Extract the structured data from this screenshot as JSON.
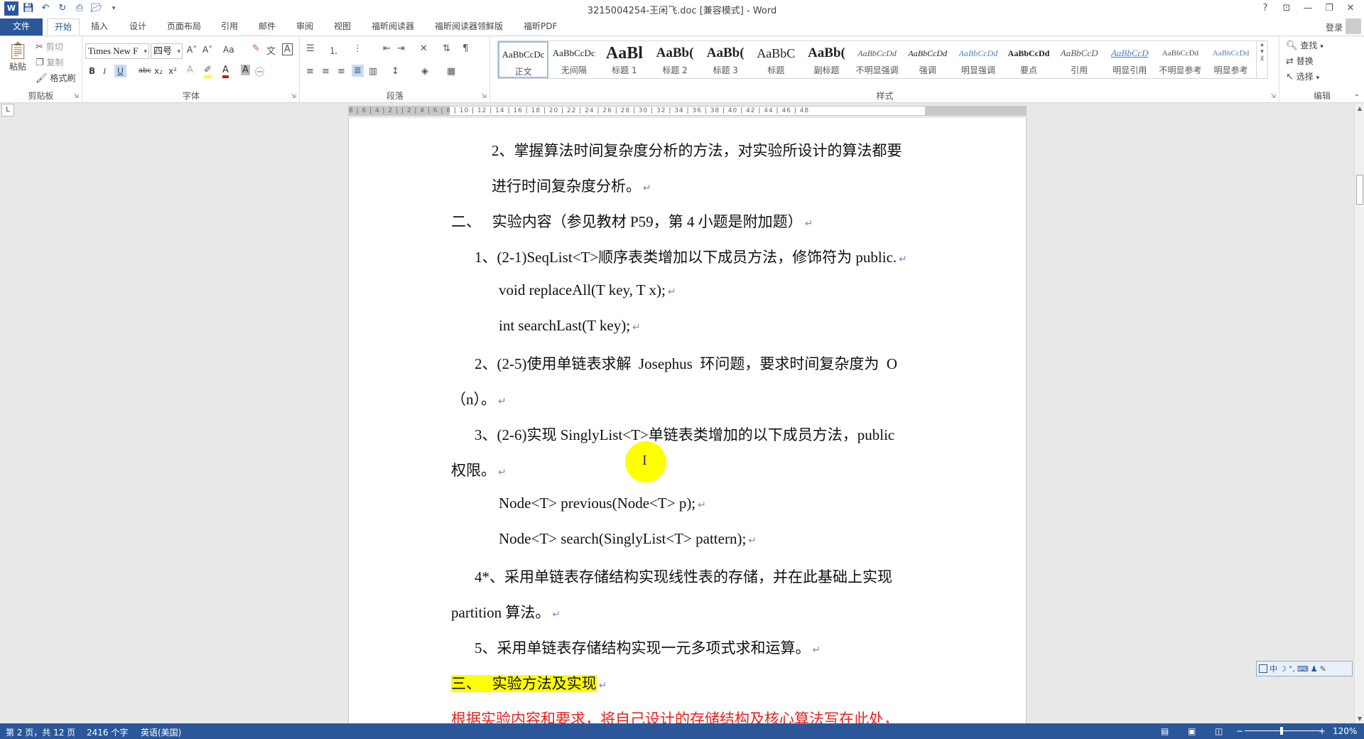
{
  "title_bar": {
    "title": "3215004254-王闲飞.doc [兼容模式] - Word",
    "controls": {
      "help": "?",
      "ribbon_display": "⊡",
      "minimize": "—",
      "restore": "❐",
      "close": "✕"
    }
  },
  "tabs": {
    "items": [
      {
        "label": "文件"
      },
      {
        "label": "开始"
      },
      {
        "label": "插入"
      },
      {
        "label": "设计"
      },
      {
        "label": "页面布局"
      },
      {
        "label": "引用"
      },
      {
        "label": "邮件"
      },
      {
        "label": "审阅"
      },
      {
        "label": "视图"
      },
      {
        "label": "福昕阅读器"
      },
      {
        "label": "福昕阅读器领鲜版"
      },
      {
        "label": "福昕PDF"
      }
    ],
    "active": "开始",
    "login": "登录"
  },
  "clipboard": {
    "paste": "粘贴",
    "cut": "剪切",
    "copy": "复制",
    "format_painter": "格式刷",
    "group_label": "剪贴板"
  },
  "font": {
    "font_name": "Times New F",
    "font_size": "四号",
    "group_label": "字体",
    "bold": "B",
    "italic": "I",
    "underline": "U",
    "strike": "abc",
    "subscript": "x₂",
    "superscript": "x²",
    "grow": "A˄",
    "shrink": "A˅",
    "case": "Aa"
  },
  "paragraph": {
    "group_label": "段落"
  },
  "styles": {
    "group_label": "样式",
    "items": [
      {
        "preview": "AaBbCcDc",
        "name": "正文"
      },
      {
        "preview": "AaBbCcDc",
        "name": "无间隔"
      },
      {
        "preview": "AaBl",
        "name": "标题 1"
      },
      {
        "preview": "AaBb(",
        "name": "标题 2"
      },
      {
        "preview": "AaBb(",
        "name": "标题 3"
      },
      {
        "preview": "AaBbC",
        "name": "标题"
      },
      {
        "preview": "AaBb(",
        "name": "副标题"
      },
      {
        "preview": "AaBbCcDd",
        "name": "不明显强调"
      },
      {
        "preview": "AaBbCcDd",
        "name": "强调"
      },
      {
        "preview": "AaBbCcDd",
        "name": "明显强调"
      },
      {
        "preview": "AaBbCcDd",
        "name": "要点"
      },
      {
        "preview": "AaBbCcD",
        "name": "引用"
      },
      {
        "preview": "AaBbCcD",
        "name": "明显引用"
      },
      {
        "preview": "AaBbCcDd",
        "name": "不明显参考"
      },
      {
        "preview": "AaBbCcDd",
        "name": "明显参考"
      }
    ]
  },
  "editing": {
    "find": "查找",
    "replace": "替换",
    "select": "选择",
    "group_label": "编辑"
  },
  "ruler": {
    "ticks": "8 | 6 | 4 | 2 |   | 2 | 4 | 6 | 8 | 10 | 12 | 14 | 16 | 18 | 20 | 22 | 24 | 26 | 28 | 30 | 32 | 34 | 36 | 38 | 40 | 42 | 44 | 46 | 48"
  },
  "document": {
    "lines": [
      {
        "text": "2、掌握算法时间复杂度分析的方法，对实验所设计的算法都要"
      },
      {
        "text": "进行时间复杂度分析。"
      },
      {
        "text": "二、   实验内容（参见教材 P59，第 4 小题是附加题）"
      },
      {
        "text": "1、(2-1)SeqList<T>顺序表类增加以下成员方法，修饰符为 public."
      },
      {
        "text": "void replaceAll(T key, T x);"
      },
      {
        "text": "int searchLast(T key);"
      },
      {
        "text": "2、(2-5)使用单链表求解  Josephus  环问题，要求时间复杂度为  O"
      },
      {
        "text": "（n）。"
      },
      {
        "text": "3、(2-6)实现 SinglyList<T>单链表类增加的以下成员方法，public"
      },
      {
        "text": "权限。"
      },
      {
        "text": "Node<T> previous(Node<T> p);"
      },
      {
        "text": "Node<T> search(SinglyList<T> pattern);"
      },
      {
        "text": "4*、采用单链表存储结构实现线性表的存储，并在此基础上实现"
      },
      {
        "text": "partition 算法。"
      },
      {
        "text": "5、采用单链表存储结构实现一元多项式求和运算。"
      },
      {
        "text": "三、   实验方法及实现"
      },
      {
        "text": "根据实验内容和要求，将自己设计的存储结构及核心算法写在此处，"
      }
    ],
    "paragraph_mark": "↵",
    "cursor_glyph": "I",
    "highlight_color": "#ffff00",
    "red_text_color": "#e8231f"
  },
  "ime": {
    "items": [
      "中",
      "☽",
      "°,",
      "⌨",
      "♟",
      "✎"
    ]
  },
  "status_bar": {
    "page": "第 2 页，共 12 页",
    "words": "2416 个字",
    "language": "英语(美国)",
    "zoom": "120%",
    "zoom_minus": "−",
    "zoom_plus": "+"
  },
  "colors": {
    "accent": "#2b579a"
  }
}
